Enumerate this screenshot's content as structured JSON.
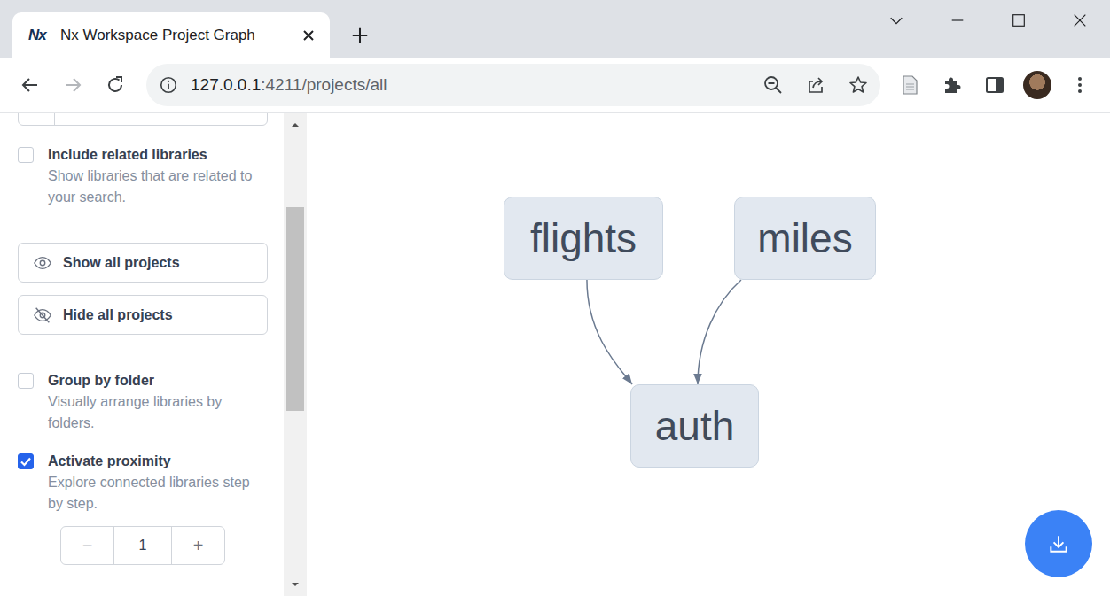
{
  "tabs": [
    {
      "icon": "Nx",
      "label": "Nx Workspace Project Graph",
      "selected": true
    }
  ],
  "address_bar": {
    "host": "127.0.0.1",
    "rest": ":4211/projects/all"
  },
  "sidebar": {
    "options": [
      {
        "kind": "checkbox",
        "label": "Include related libraries",
        "description": "Show libraries that are related to your search.",
        "checked": false
      },
      {
        "kind": "button",
        "label": "Show all projects"
      },
      {
        "kind": "button",
        "label": "Hide all projects"
      },
      {
        "kind": "checkbox",
        "label": "Group by folder",
        "description": "Visually arrange libraries by folders.",
        "checked": false
      },
      {
        "kind": "checkbox",
        "label": "Activate proximity",
        "description": "Explore connected libraries step by step.",
        "checked": true
      }
    ],
    "stepper": {
      "decrement": "−",
      "value": "1",
      "increment": "+"
    }
  },
  "graph": {
    "nodes": [
      {
        "label": "flights"
      },
      {
        "label": "miles"
      },
      {
        "label": "auth"
      }
    ],
    "edges": [
      {
        "from": "flights",
        "to": "auth"
      },
      {
        "from": "miles",
        "to": "auth"
      }
    ]
  }
}
